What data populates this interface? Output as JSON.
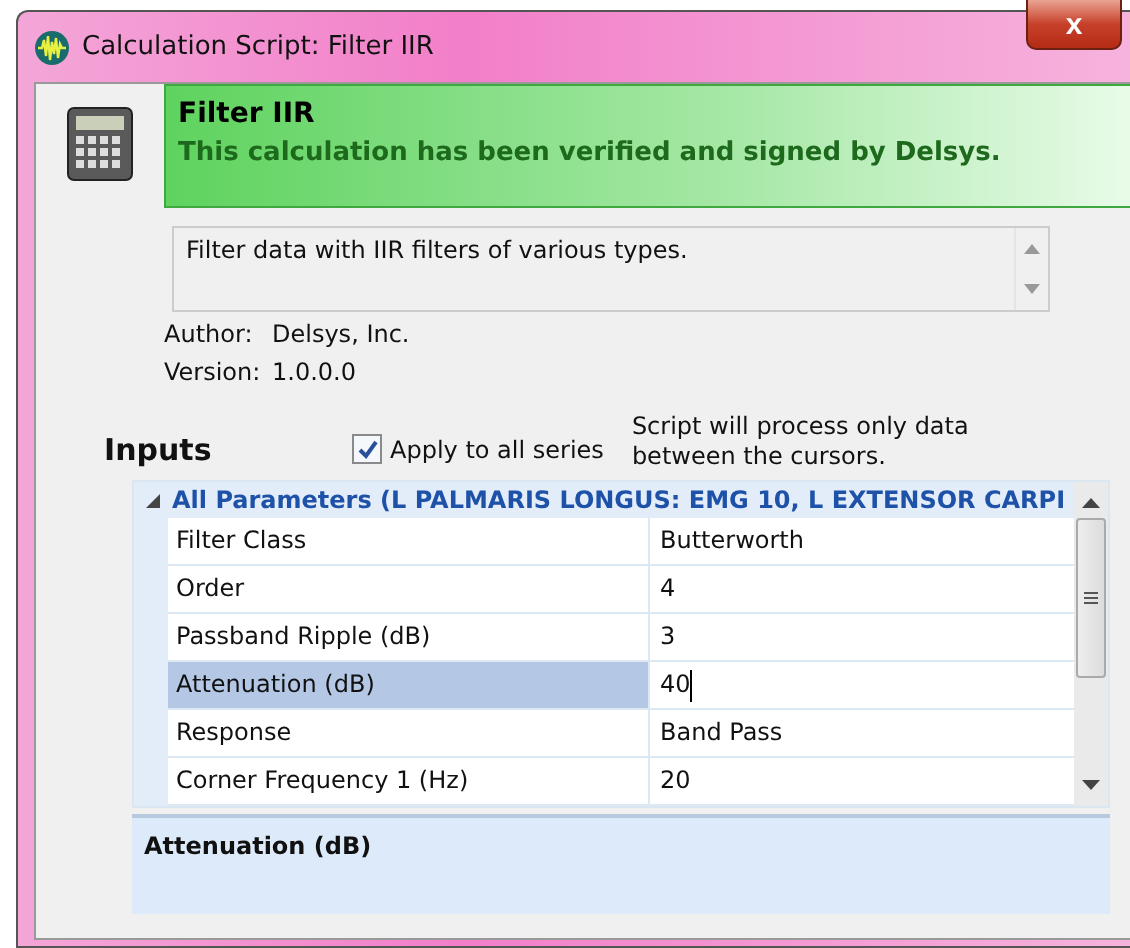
{
  "window": {
    "title": "Calculation Script: Filter IIR",
    "close": "x"
  },
  "banner": {
    "title": "Filter IIR",
    "status": "This calculation has been verified and signed by Delsys."
  },
  "description": "Filter data with IIR filters of various types.",
  "info": [
    {
      "label": "Author:",
      "value": "Delsys, Inc."
    },
    {
      "label": "Version:",
      "value": "1.0.0.0"
    }
  ],
  "inputs": {
    "heading": "Inputs",
    "apply_all": {
      "label": "Apply to all series",
      "checked": true
    },
    "note": "Script will process only data between the cursors."
  },
  "grid": {
    "category": {
      "label": "All Parameters (L PALMARIS LONGUS: EMG 10, L EXTENSOR CARPI",
      "expanded": true
    },
    "rows": [
      {
        "name": "Filter Class",
        "value": "Butterworth",
        "selected": false
      },
      {
        "name": "Order",
        "value": "4",
        "selected": false
      },
      {
        "name": "Passband Ripple (dB)",
        "value": "3",
        "selected": false
      },
      {
        "name": "Attenuation (dB)",
        "value": "40",
        "selected": true
      },
      {
        "name": "Response",
        "value": "Band Pass",
        "selected": false
      },
      {
        "name": "Corner Frequency 1 (Hz)",
        "value": "20",
        "selected": false
      }
    ]
  },
  "help": {
    "title": "Attenuation (dB)"
  }
}
